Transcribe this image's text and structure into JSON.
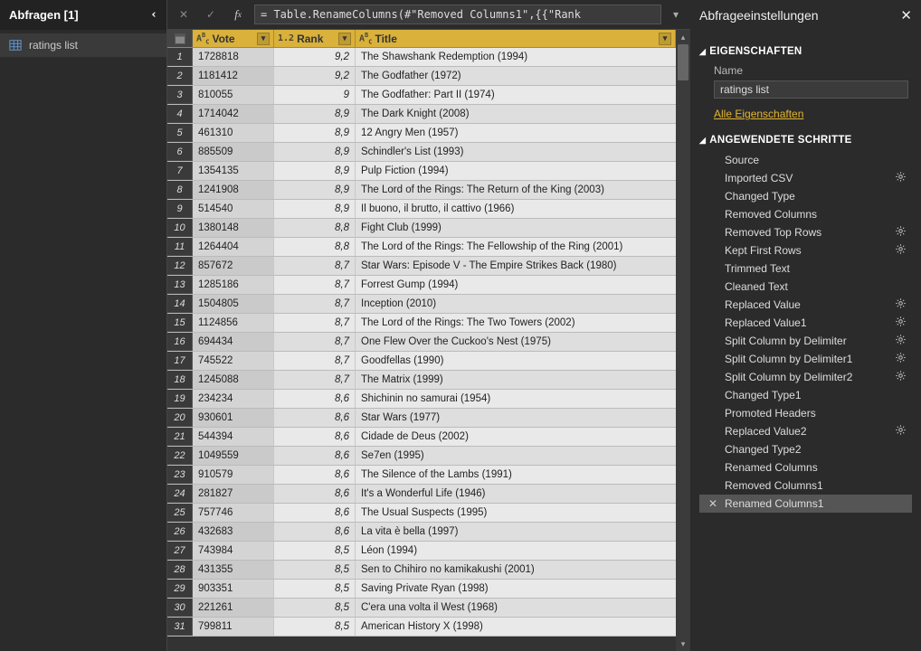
{
  "left": {
    "header": "Abfragen [1]",
    "query_name": "ratings list"
  },
  "formula": {
    "text": "= Table.RenameColumns(#\"Removed Columns1\",{{\"Rank"
  },
  "columns": {
    "vote": "Vote",
    "rank": "Rank",
    "title": "Title"
  },
  "rows": [
    {
      "n": "1",
      "vote": "1728818",
      "rank": "9,2",
      "title": "The Shawshank Redemption (1994)"
    },
    {
      "n": "2",
      "vote": "1181412",
      "rank": "9,2",
      "title": "The Godfather (1972)"
    },
    {
      "n": "3",
      "vote": "810055",
      "rank": "9",
      "title": "The Godfather: Part II (1974)"
    },
    {
      "n": "4",
      "vote": "1714042",
      "rank": "8,9",
      "title": "The Dark Knight (2008)"
    },
    {
      "n": "5",
      "vote": "461310",
      "rank": "8,9",
      "title": "12 Angry Men (1957)"
    },
    {
      "n": "6",
      "vote": "885509",
      "rank": "8,9",
      "title": "Schindler's List (1993)"
    },
    {
      "n": "7",
      "vote": "1354135",
      "rank": "8,9",
      "title": "Pulp Fiction (1994)"
    },
    {
      "n": "8",
      "vote": "1241908",
      "rank": "8,9",
      "title": "The Lord of the Rings: The Return of the King (2003)"
    },
    {
      "n": "9",
      "vote": "514540",
      "rank": "8,9",
      "title": "Il buono, il brutto, il cattivo (1966)"
    },
    {
      "n": "10",
      "vote": "1380148",
      "rank": "8,8",
      "title": "Fight Club (1999)"
    },
    {
      "n": "11",
      "vote": "1264404",
      "rank": "8,8",
      "title": "The Lord of the Rings: The Fellowship of the Ring (2001)"
    },
    {
      "n": "12",
      "vote": "857672",
      "rank": "8,7",
      "title": "Star Wars: Episode V - The Empire Strikes Back (1980)"
    },
    {
      "n": "13",
      "vote": "1285186",
      "rank": "8,7",
      "title": "Forrest Gump (1994)"
    },
    {
      "n": "14",
      "vote": "1504805",
      "rank": "8,7",
      "title": "Inception (2010)"
    },
    {
      "n": "15",
      "vote": "1124856",
      "rank": "8,7",
      "title": "The Lord of the Rings: The Two Towers (2002)"
    },
    {
      "n": "16",
      "vote": "694434",
      "rank": "8,7",
      "title": "One Flew Over the Cuckoo's Nest (1975)"
    },
    {
      "n": "17",
      "vote": "745522",
      "rank": "8,7",
      "title": "Goodfellas (1990)"
    },
    {
      "n": "18",
      "vote": "1245088",
      "rank": "8,7",
      "title": "The Matrix (1999)"
    },
    {
      "n": "19",
      "vote": "234234",
      "rank": "8,6",
      "title": "Shichinin no samurai (1954)"
    },
    {
      "n": "20",
      "vote": "930601",
      "rank": "8,6",
      "title": "Star Wars (1977)"
    },
    {
      "n": "21",
      "vote": "544394",
      "rank": "8,6",
      "title": "Cidade de Deus (2002)"
    },
    {
      "n": "22",
      "vote": "1049559",
      "rank": "8,6",
      "title": "Se7en (1995)"
    },
    {
      "n": "23",
      "vote": "910579",
      "rank": "8,6",
      "title": "The Silence of the Lambs (1991)"
    },
    {
      "n": "24",
      "vote": "281827",
      "rank": "8,6",
      "title": "It's a Wonderful Life (1946)"
    },
    {
      "n": "25",
      "vote": "757746",
      "rank": "8,6",
      "title": "The Usual Suspects (1995)"
    },
    {
      "n": "26",
      "vote": "432683",
      "rank": "8,6",
      "title": "La vita è bella (1997)"
    },
    {
      "n": "27",
      "vote": "743984",
      "rank": "8,5",
      "title": "Léon (1994)"
    },
    {
      "n": "28",
      "vote": "431355",
      "rank": "8,5",
      "title": "Sen to Chihiro no kamikakushi (2001)"
    },
    {
      "n": "29",
      "vote": "903351",
      "rank": "8,5",
      "title": "Saving Private Ryan (1998)"
    },
    {
      "n": "30",
      "vote": "221261",
      "rank": "8,5",
      "title": "C'era una volta il West (1968)"
    },
    {
      "n": "31",
      "vote": "799811",
      "rank": "8,5",
      "title": "American History X (1998)"
    }
  ],
  "right": {
    "title": "Abfrageeinstellungen",
    "sec_props": "EIGENSCHAFTEN",
    "name_label": "Name",
    "name_value": "ratings list",
    "all_props": "Alle Eigenschaften",
    "sec_steps": "ANGEWENDETE SCHRITTE",
    "steps": [
      {
        "label": "Source",
        "gear": false
      },
      {
        "label": "Imported CSV",
        "gear": true
      },
      {
        "label": "Changed Type",
        "gear": false
      },
      {
        "label": "Removed Columns",
        "gear": false
      },
      {
        "label": "Removed Top Rows",
        "gear": true
      },
      {
        "label": "Kept First Rows",
        "gear": true
      },
      {
        "label": "Trimmed Text",
        "gear": false
      },
      {
        "label": "Cleaned Text",
        "gear": false
      },
      {
        "label": "Replaced Value",
        "gear": true
      },
      {
        "label": "Replaced Value1",
        "gear": true
      },
      {
        "label": "Split Column by Delimiter",
        "gear": true
      },
      {
        "label": "Split Column by Delimiter1",
        "gear": true
      },
      {
        "label": "Split Column by Delimiter2",
        "gear": true
      },
      {
        "label": "Changed Type1",
        "gear": false
      },
      {
        "label": "Promoted Headers",
        "gear": false
      },
      {
        "label": "Replaced Value2",
        "gear": true
      },
      {
        "label": "Changed Type2",
        "gear": false
      },
      {
        "label": "Renamed Columns",
        "gear": false
      },
      {
        "label": "Removed Columns1",
        "gear": false
      },
      {
        "label": "Renamed Columns1",
        "gear": false,
        "selected": true
      }
    ]
  }
}
